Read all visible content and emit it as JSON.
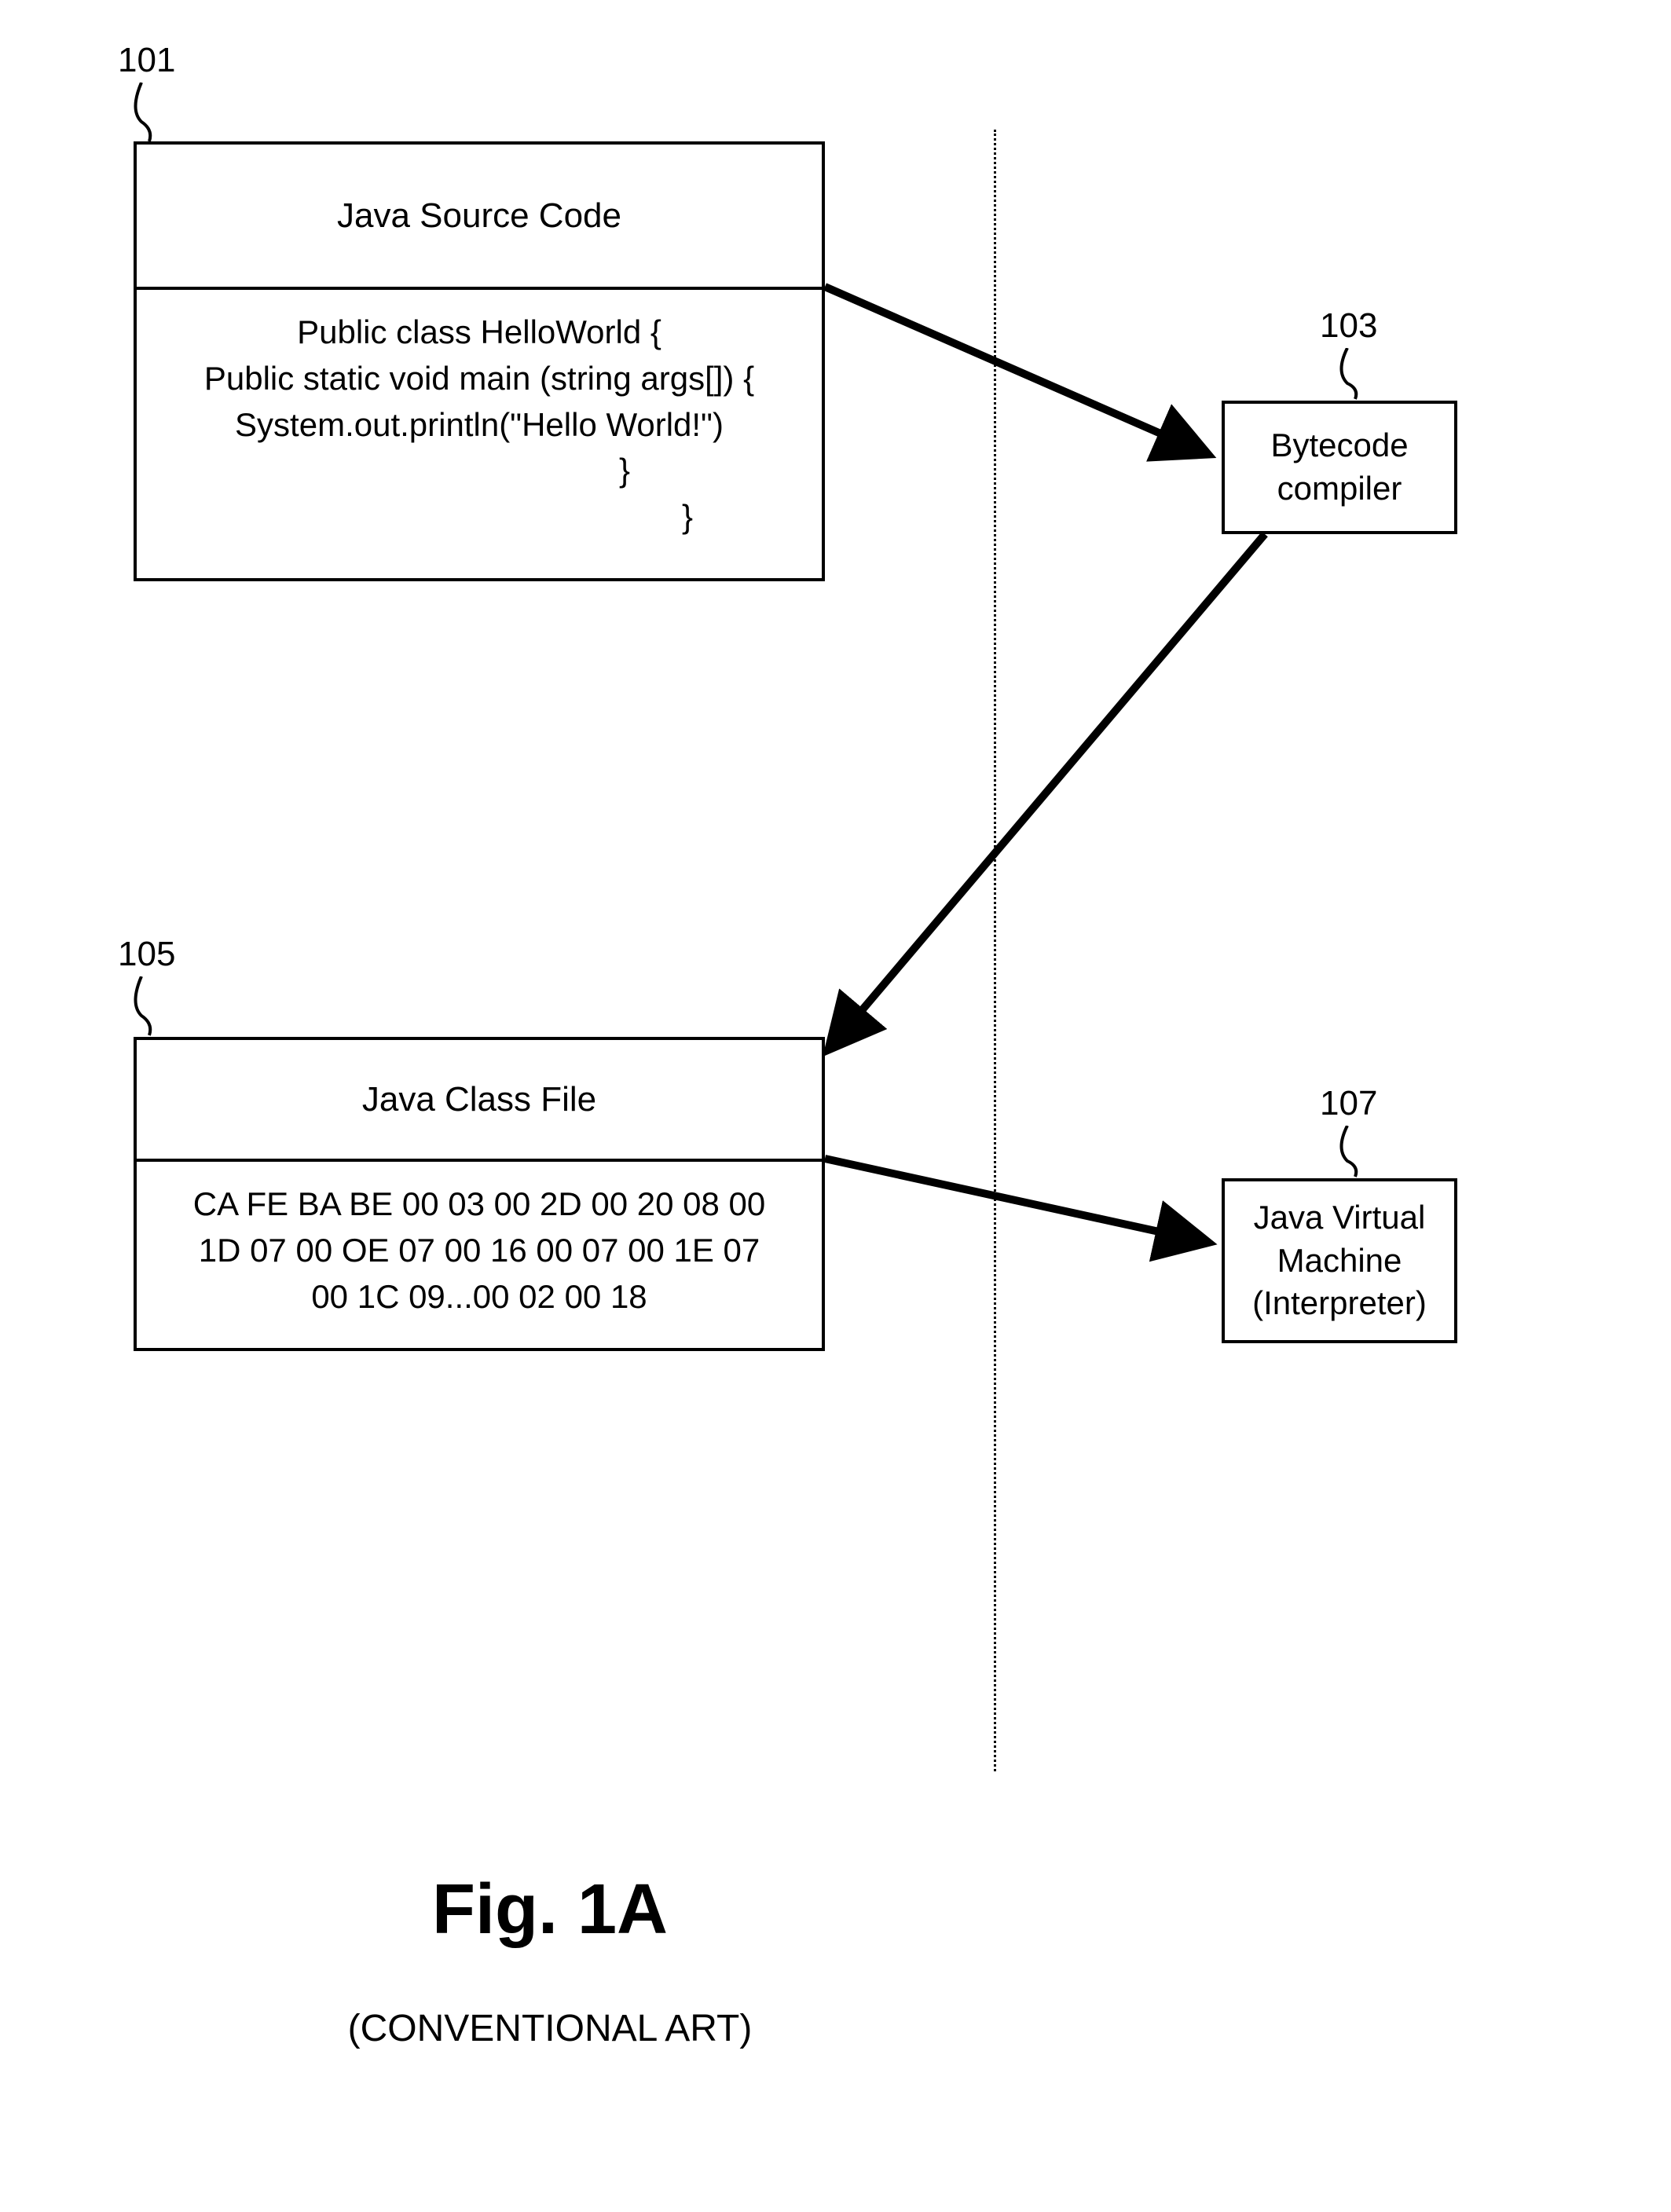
{
  "refs": {
    "source": "101",
    "compiler": "103",
    "classfile": "105",
    "jvm": "107"
  },
  "boxes": {
    "source": {
      "header": "Java Source Code",
      "line1": "Public class HelloWorld {",
      "line2": "Public static void main (string args[]) {",
      "line3": "System.out.println(\"Hello World!\")",
      "line4": "}",
      "line5": "}"
    },
    "classfile": {
      "header": "Java Class File",
      "line1": "CA FE BA BE 00 03 00 2D 00 20 08 00",
      "line2": "1D 07 00 OE 07 00 16 00 07 00 1E 07",
      "line3": "00 1C 09...00 02 00 18"
    },
    "compiler": {
      "line1": "Bytecode",
      "line2": "compiler"
    },
    "jvm": {
      "line1": "Java Virtual",
      "line2": "Machine",
      "line3": "(Interpreter)"
    }
  },
  "figure": {
    "title": "Fig. 1A",
    "subtitle": "(CONVENTIONAL ART)"
  }
}
